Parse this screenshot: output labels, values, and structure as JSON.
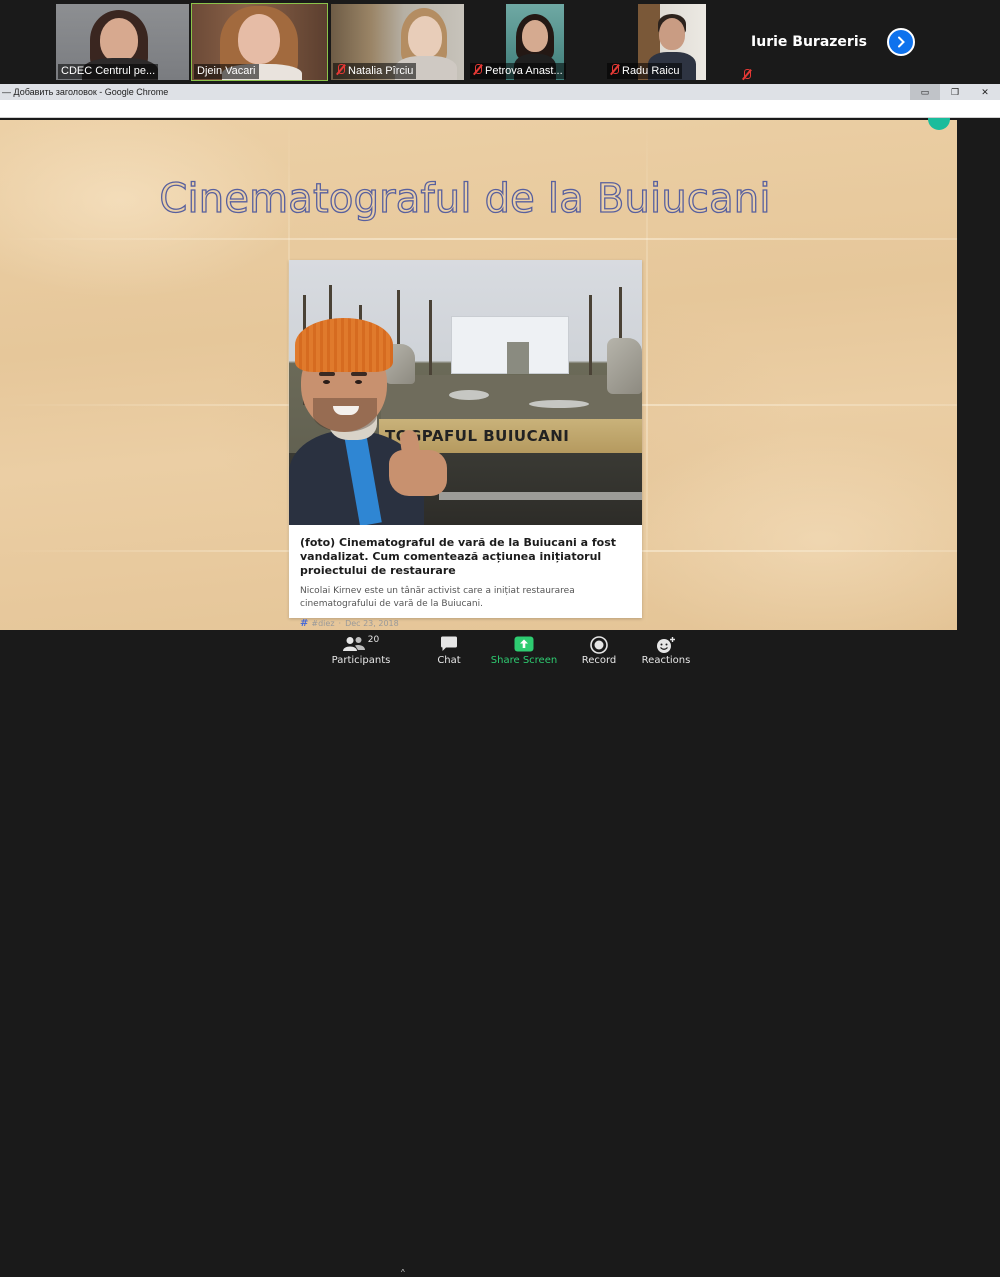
{
  "participants": [
    {
      "name": "CDEC Centrul pe...",
      "muted": false,
      "active": false
    },
    {
      "name": "Djein Vacari",
      "muted": false,
      "active": true
    },
    {
      "name": "Natalia Pîrciu",
      "muted": true,
      "active": false
    },
    {
      "name": "Petrova Anast...",
      "muted": true,
      "active": false
    },
    {
      "name": "Radu Raicu",
      "muted": true,
      "active": false
    },
    {
      "name": "Iurie Burazeris",
      "muted": true,
      "active": false
    }
  ],
  "participants_next_icon": "chevron-right-icon",
  "browser": {
    "window_title": "— Добавить заголовок - Google Chrome",
    "controls": {
      "minimize": "▭",
      "restore": "❐",
      "close": "✕"
    }
  },
  "slide": {
    "title": "Cinematograful de la Buiucani",
    "accent_color": "#58609e"
  },
  "article": {
    "photo_sign_text": "TOGPAFUL  BUIUCANI",
    "title": "(foto) Cinematograful de vară de la Buiucani a fost vandalizat. Cum comentează acțiunea inițiatorul proiectului de restaurare",
    "description": "Nicolai Kirnev este un tânăr activist care a inițiat restaurarea cinematografului de vară de la Buiucani.",
    "tag_icon": "#",
    "tag": "#diez",
    "date": "Dec 23, 2018"
  },
  "toolbar": {
    "participants": {
      "label": "Participants",
      "count": "20",
      "icon": "participants-icon"
    },
    "chat": {
      "label": "Chat",
      "icon": "chat-icon"
    },
    "share": {
      "label": "Share Screen",
      "icon": "share-screen-icon",
      "color": "#2ecc71"
    },
    "record": {
      "label": "Record",
      "icon": "record-icon"
    },
    "reactions": {
      "label": "Reactions",
      "icon": "reactions-icon"
    },
    "participants_caret": "^"
  }
}
